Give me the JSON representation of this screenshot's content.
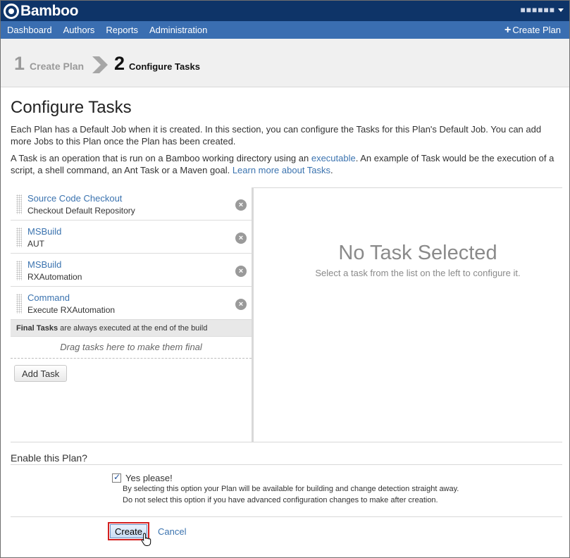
{
  "header": {
    "app_name": "Bamboo",
    "user_name": "■■■■■■"
  },
  "nav": {
    "items": [
      "Dashboard",
      "Authors",
      "Reports",
      "Administration"
    ],
    "create_plan": "Create Plan"
  },
  "steps": {
    "step1_num": "1",
    "step1_label": "Create Plan",
    "step2_num": "2",
    "step2_label": "Configure Tasks"
  },
  "page": {
    "title": "Configure Tasks",
    "intro1": "Each Plan has a Default Job when it is created. In this section, you can configure the Tasks for this Plan's Default Job. You can add more Jobs to this Plan once the Plan has been created.",
    "intro2_a": "A Task is an operation that is run on a Bamboo working directory using an ",
    "intro2_link1": "executable",
    "intro2_b": ". An example of Task would be the execution of a script, a shell command, an Ant Task or a Maven goal. ",
    "intro2_link2": "Learn more about Tasks",
    "intro2_c": "."
  },
  "tasks": [
    {
      "name": "Source Code Checkout",
      "desc": "Checkout Default Repository"
    },
    {
      "name": "MSBuild",
      "desc": "AUT"
    },
    {
      "name": "MSBuild",
      "desc": "RXAutomation"
    },
    {
      "name": "Command",
      "desc": "Execute RXAutomation"
    }
  ],
  "final_tasks": {
    "label_bold": "Final Tasks",
    "label_rest": " are always executed at the end of the build",
    "drop_hint": "Drag tasks here to make them final"
  },
  "add_task_label": "Add Task",
  "no_task": {
    "title": "No Task Selected",
    "subtitle": "Select a task from the list on the left to configure it."
  },
  "enable": {
    "title": "Enable this Plan?",
    "checkbox_label": "Yes please!",
    "checked": true,
    "help1": "By selecting this option your Plan will be available for building and change detection straight away.",
    "help2": "Do not select this option if you have advanced configuration changes to make after creation."
  },
  "actions": {
    "create_label": "Create",
    "cancel_label": "Cancel"
  }
}
